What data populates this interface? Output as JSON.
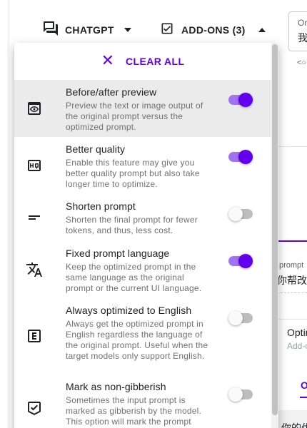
{
  "header": {
    "model_label": "CHATGPT",
    "addons_label": "ADD-ONS (3)"
  },
  "background": {
    "original_label": "Ori",
    "original_value": "我",
    "prompt_label": "prompt",
    "prompt_value": "你帮改",
    "optimize_label": "Optim",
    "optimize_sub": "Add-o",
    "tab_label": "O",
    "bottom_text": "你的优"
  },
  "dropdown": {
    "clear_all_label": "CLEAR ALL",
    "items": [
      {
        "title": "Before/after preview",
        "description": "Preview the text or image output of the original prompt versus the optimized prompt.",
        "enabled": true,
        "icon": "preview-icon"
      },
      {
        "title": "Better quality",
        "description": "Enable this feature may give you better quality prompt but also take longer time to optimize.",
        "enabled": true,
        "icon": "hq-icon"
      },
      {
        "title": "Shorten prompt",
        "description": "Shorten the final prompt for fewer tokens, and thus, less cost.",
        "enabled": false,
        "icon": "short-text-icon"
      },
      {
        "title": "Fixed prompt language",
        "description": "Keep the optimized prompt in the same language as the original prompt or the current UI language.",
        "enabled": true,
        "icon": "translate-icon"
      },
      {
        "title": "Always optimized to English",
        "description": "Always get the optimized prompt in English regardless the language of the original prompt. Useful when the target models only support English.",
        "enabled": false,
        "icon": "english-e-icon"
      },
      {
        "title": "Mark as non-gibberish",
        "description": "Sometimes the input prompt is marked as gibberish by the model. This option will mark the prompt",
        "enabled": false,
        "icon": "verified-check-icon"
      }
    ]
  },
  "colors": {
    "accent": "#6200ee",
    "switch_track_on": "#9e74f0",
    "switch_track_off": "#bdbdbd",
    "highlight": "#ebebeb"
  }
}
